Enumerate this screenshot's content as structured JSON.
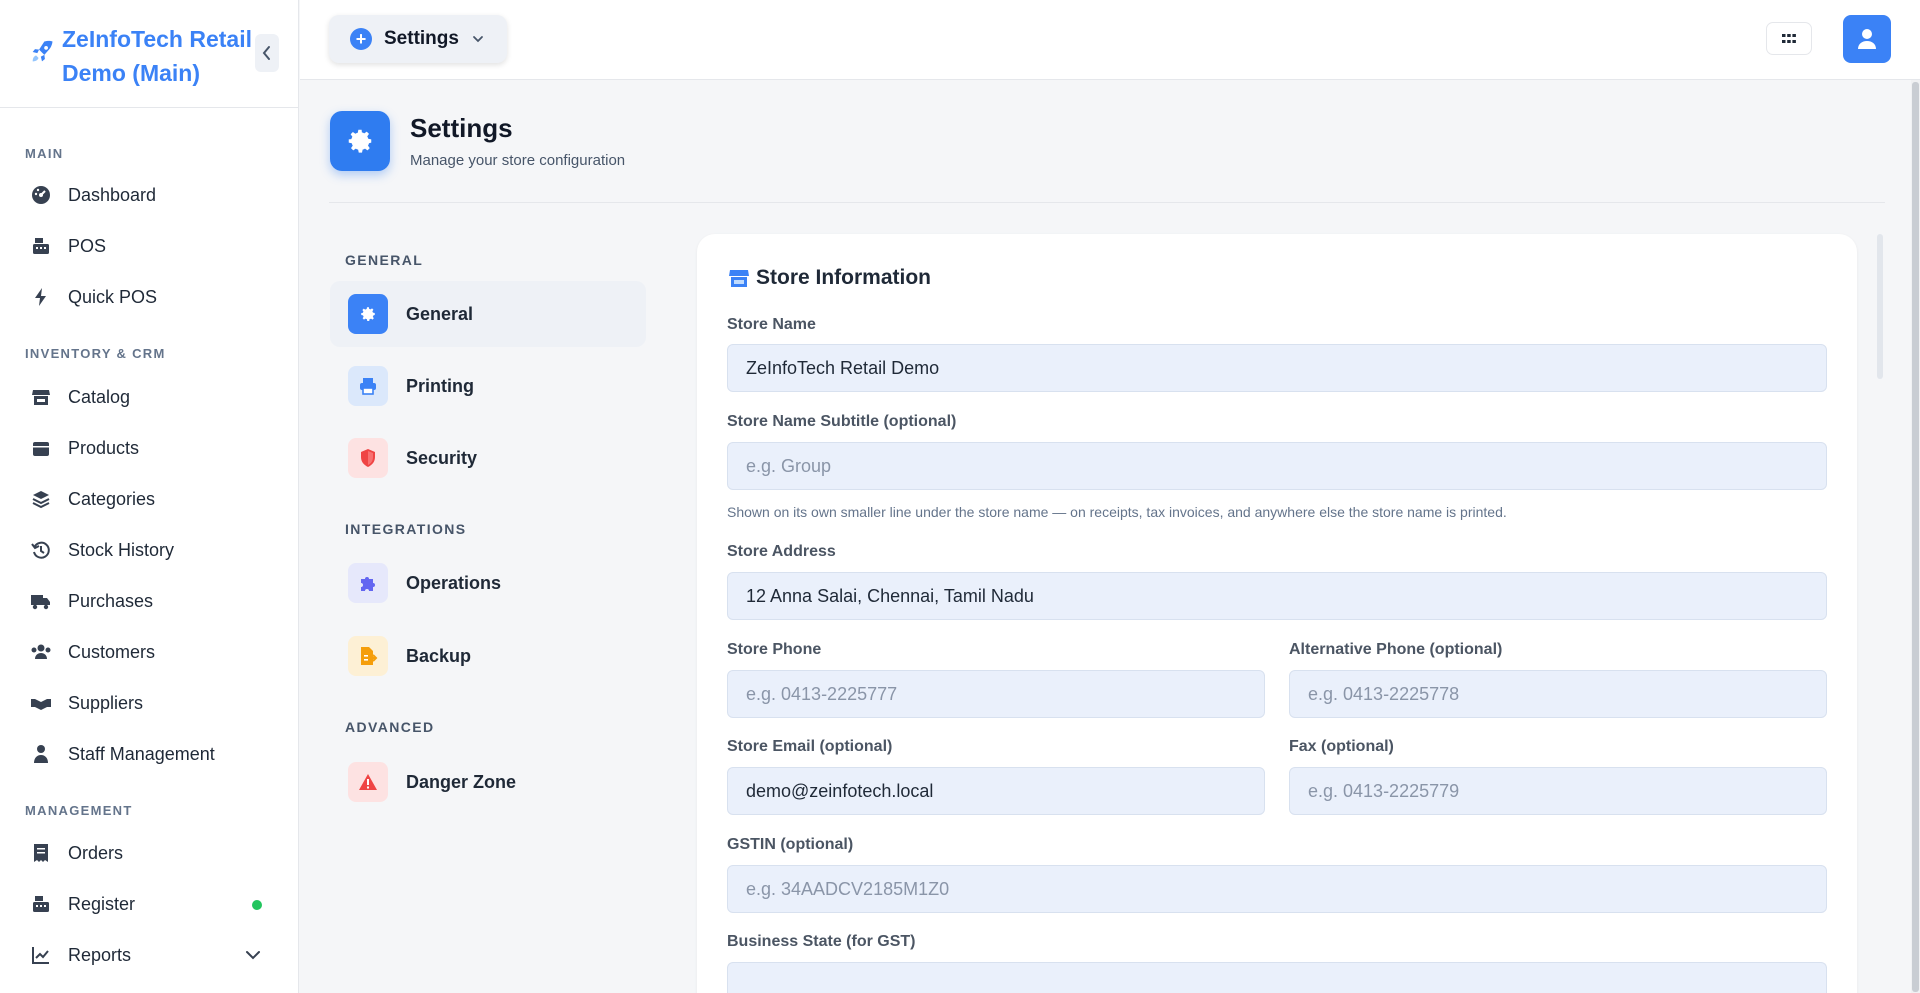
{
  "brand": {
    "title": "ZeInfoTech Retail Demo (Main)"
  },
  "sidebar": {
    "sections": [
      {
        "label": "MAIN",
        "items": [
          {
            "label": "Dashboard",
            "icon": "dashboard-icon"
          },
          {
            "label": "POS",
            "icon": "cash-register-icon"
          },
          {
            "label": "Quick POS",
            "icon": "bolt-icon"
          }
        ]
      },
      {
        "label": "INVENTORY & CRM",
        "items": [
          {
            "label": "Catalog",
            "icon": "store-icon"
          },
          {
            "label": "Products",
            "icon": "box-icon"
          },
          {
            "label": "Categories",
            "icon": "layers-icon"
          },
          {
            "label": "Stock History",
            "icon": "history-icon"
          },
          {
            "label": "Purchases",
            "icon": "truck-icon"
          },
          {
            "label": "Customers",
            "icon": "users-icon"
          },
          {
            "label": "Suppliers",
            "icon": "handshake-icon"
          },
          {
            "label": "Staff Management",
            "icon": "user-tie-icon"
          }
        ]
      },
      {
        "label": "MANAGEMENT",
        "items": [
          {
            "label": "Orders",
            "icon": "receipt-icon"
          },
          {
            "label": "Register",
            "icon": "register-icon",
            "status_color": "#22c55e"
          },
          {
            "label": "Reports",
            "icon": "chart-line-icon"
          }
        ]
      }
    ]
  },
  "topbar": {
    "page_switch_label": "Settings"
  },
  "header": {
    "title": "Settings",
    "subtitle": "Manage your store configuration"
  },
  "settings_nav": {
    "groups": [
      {
        "label": "GENERAL",
        "items": [
          {
            "label": "General",
            "icon": "gear-icon",
            "active": true
          },
          {
            "label": "Printing",
            "icon": "printer-icon"
          },
          {
            "label": "Security",
            "icon": "shield-icon"
          }
        ]
      },
      {
        "label": "INTEGRATIONS",
        "items": [
          {
            "label": "Operations",
            "icon": "puzzle-icon"
          },
          {
            "label": "Backup",
            "icon": "file-export-icon"
          }
        ]
      },
      {
        "label": "ADVANCED",
        "items": [
          {
            "label": "Danger Zone",
            "icon": "warning-icon"
          }
        ]
      }
    ]
  },
  "store_info": {
    "title": "Store Information",
    "store_name": {
      "label": "Store Name",
      "value": "ZeInfoTech Retail Demo"
    },
    "subtitle": {
      "label": "Store Name Subtitle (optional)",
      "placeholder": "e.g. Group",
      "hint": "Shown on its own smaller line under the store name — on receipts, tax invoices, and anywhere else the store name is printed."
    },
    "address": {
      "label": "Store Address",
      "value": "12 Anna Salai, Chennai, Tamil Nadu"
    },
    "phone": {
      "label": "Store Phone",
      "placeholder": "e.g. 0413-2225777"
    },
    "alt_phone": {
      "label": "Alternative Phone (optional)",
      "placeholder": "e.g. 0413-2225778"
    },
    "email": {
      "label": "Store Email (optional)",
      "value": "demo@zeinfotech.local"
    },
    "fax": {
      "label": "Fax (optional)",
      "placeholder": "e.g. 0413-2225779"
    },
    "gstin": {
      "label": "GSTIN (optional)",
      "placeholder": "e.g. 34AADCV2185M1Z0"
    },
    "business_state": {
      "label": "Business State (for GST)"
    }
  },
  "colors": {
    "accent": "#3b82f6",
    "success": "#22c55e",
    "danger": "#ef4444"
  }
}
